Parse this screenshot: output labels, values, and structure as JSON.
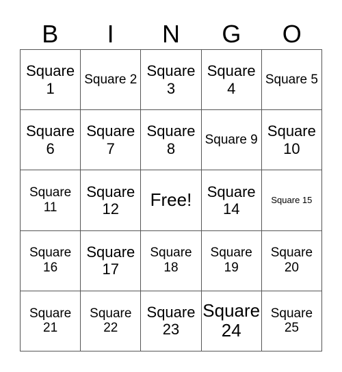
{
  "header": [
    "B",
    "I",
    "N",
    "G",
    "O"
  ],
  "cells": [
    {
      "text": "Square 1",
      "size": "s-m"
    },
    {
      "text": "Square 2",
      "size": "s-s"
    },
    {
      "text": "Square 3",
      "size": "s-m"
    },
    {
      "text": "Square 4",
      "size": "s-m"
    },
    {
      "text": "Square 5",
      "size": "s-s"
    },
    {
      "text": "Square 6",
      "size": "s-m"
    },
    {
      "text": "Square 7",
      "size": "s-m"
    },
    {
      "text": "Square 8",
      "size": "s-m"
    },
    {
      "text": "Square 9",
      "size": "s-s"
    },
    {
      "text": "Square 10",
      "size": "s-m"
    },
    {
      "text": "Square 11",
      "size": "s-s"
    },
    {
      "text": "Square 12",
      "size": "s-m"
    },
    {
      "text": "Free!",
      "size": "s-l"
    },
    {
      "text": "Square 14",
      "size": "s-m"
    },
    {
      "text": "Square 15",
      "size": "s-xs"
    },
    {
      "text": "Square 16",
      "size": "s-s"
    },
    {
      "text": "Square 17",
      "size": "s-m"
    },
    {
      "text": "Square 18",
      "size": "s-s"
    },
    {
      "text": "Square 19",
      "size": "s-s"
    },
    {
      "text": "Square 20",
      "size": "s-s"
    },
    {
      "text": "Square 21",
      "size": "s-s"
    },
    {
      "text": "Square 22",
      "size": "s-s"
    },
    {
      "text": "Square 23",
      "size": "s-m"
    },
    {
      "text": "Square 24",
      "size": "s-l"
    },
    {
      "text": "Square 25",
      "size": "s-s"
    }
  ]
}
